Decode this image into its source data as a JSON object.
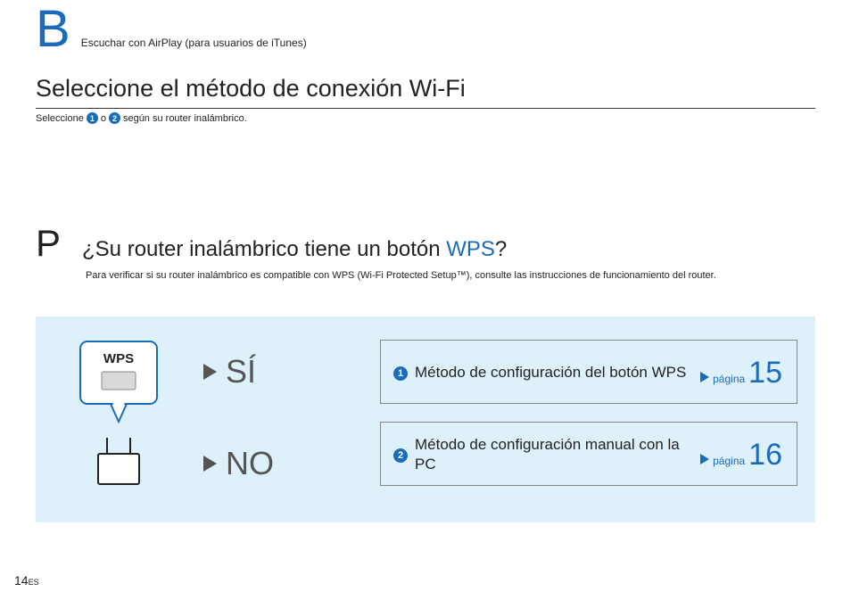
{
  "header": {
    "letter": "B",
    "subtitle": "Escuchar con AirPlay (para usuarios de iTunes)"
  },
  "title": "Seleccione el método de conexión Wi-Fi",
  "instruction": {
    "pre": "Seleccione",
    "n1": "1",
    "mid": "o",
    "n2": "2",
    "post": "según su router inalámbrico."
  },
  "question": {
    "letter": "P",
    "text_pre": "¿Su router inalámbrico tiene un botón ",
    "wps": "WPS",
    "text_post": "?",
    "note": "Para verificar si su router inalámbrico es compatible con WPS (Wi-Fi Protected Setup™), consulte las instrucciones de funcionamiento del router."
  },
  "icon": {
    "wps_label": "WPS"
  },
  "choices": {
    "yes": "SÍ",
    "no": "NO"
  },
  "methods": [
    {
      "num": "1",
      "text": "Método de configuración del botón WPS",
      "page_label": "página",
      "page": "15"
    },
    {
      "num": "2",
      "text": "Método de configuración manual con la PC",
      "page_label": "página",
      "page": "16"
    }
  ],
  "footer": {
    "page": "14",
    "lang": "ES"
  }
}
